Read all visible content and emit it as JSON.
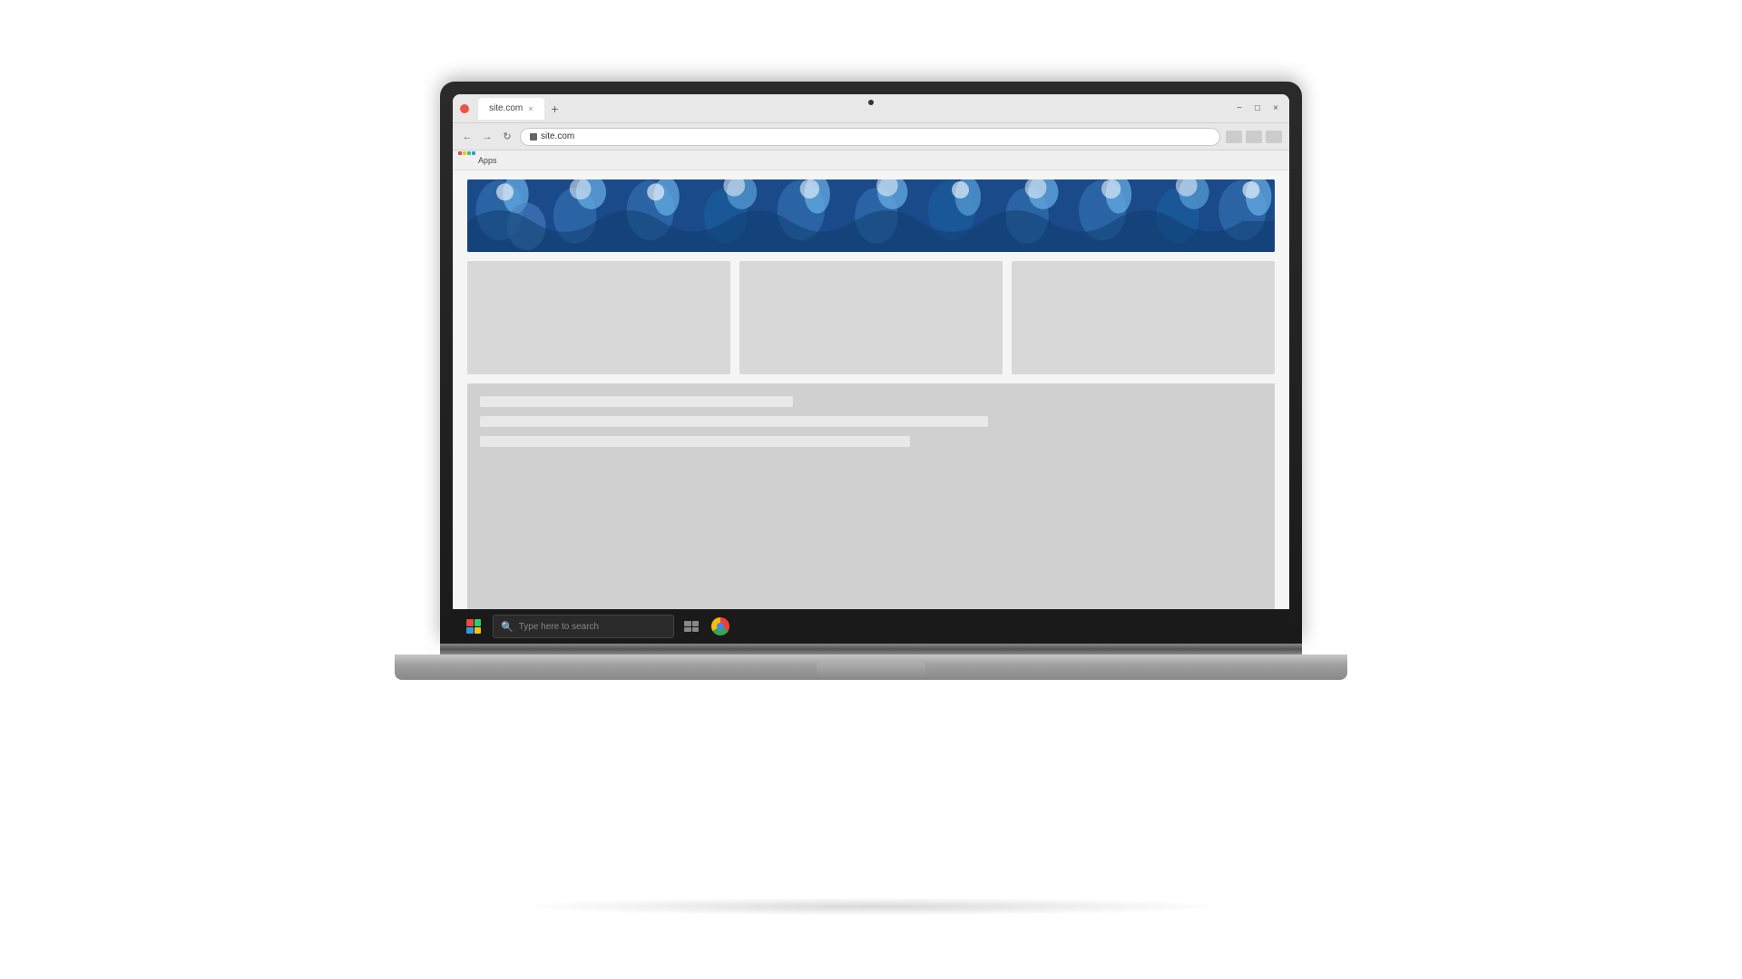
{
  "scene": {
    "background": "#ffffff"
  },
  "browser": {
    "tab": {
      "label": "site.com"
    },
    "address": {
      "url": "site.com",
      "favicon": "🌐"
    },
    "bookmarks": {
      "apps_label": "Apps"
    },
    "window_controls": {
      "minimize": "−",
      "maximize": "□",
      "close": "×"
    }
  },
  "website": {
    "hero": {
      "alt": "Decorative blue wave pattern banner"
    },
    "cards": [
      {
        "id": "card-1",
        "alt": "Content placeholder 1"
      },
      {
        "id": "card-2",
        "alt": "Content placeholder 2"
      },
      {
        "id": "card-3",
        "alt": "Content placeholder 3"
      }
    ],
    "content_block": {
      "line1": "",
      "line2": "",
      "line3": ""
    }
  },
  "taskbar": {
    "search_placeholder": "Type here to search",
    "apps": [
      {
        "id": "task-view",
        "label": "Task View"
      },
      {
        "id": "chrome",
        "label": "Google Chrome"
      }
    ]
  }
}
